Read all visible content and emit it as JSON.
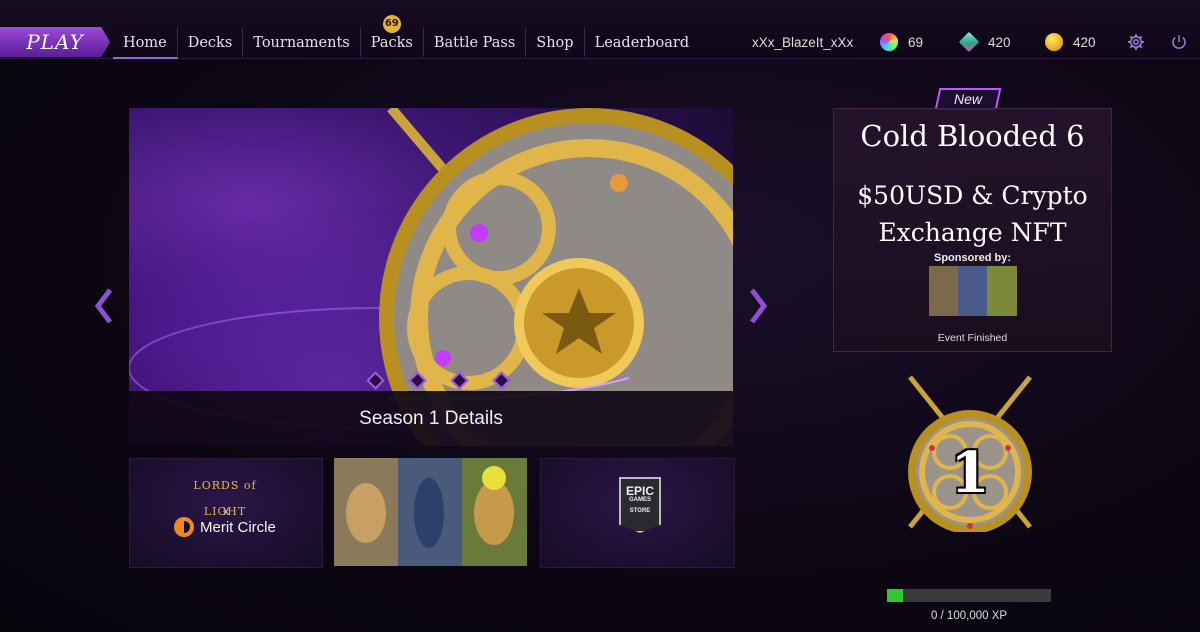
{
  "header": {
    "play_label": "PLAY",
    "nav": [
      {
        "label": "Home",
        "active": true
      },
      {
        "label": "Decks"
      },
      {
        "label": "Tournaments"
      },
      {
        "label": "Packs",
        "badge": "69"
      },
      {
        "label": "Battle Pass"
      },
      {
        "label": "Shop"
      },
      {
        "label": "Leaderboard"
      }
    ],
    "username": "xXx_BlazeIt_xXx",
    "currencies": {
      "gems": {
        "icon": "rainbow-gem-icon",
        "value": "69"
      },
      "shards": {
        "icon": "crystal-cube-icon",
        "value": "420"
      },
      "coins": {
        "icon": "gold-coin-icon",
        "value": "420"
      }
    },
    "icons": {
      "settings": "gear-icon",
      "logout": "power-icon"
    }
  },
  "banner": {
    "caption": "Season 1 Details",
    "slide_count": 4
  },
  "promo_tiles": {
    "tile1": {
      "logo_text": "LORDS of LIGHT",
      "separator": "x",
      "partner": "Merit Circle"
    },
    "tile3": {
      "line1": "EPIC",
      "line2": "GAMES",
      "line3": "STORE"
    }
  },
  "event": {
    "tag": "New",
    "title": "Cold Blooded 6",
    "prize_line1": "$50USD & Crypto",
    "prize_line2": "Exchange NFT",
    "sponsored_label": "Sponsored by:",
    "status": "Event Finished"
  },
  "rank": {
    "level": "1",
    "xp_label": "0 / 100,000 XP",
    "xp_fill_fraction": 0.1
  },
  "colors": {
    "accent_purple": "#9b5ee0",
    "gold": "#e0b23a",
    "xp_green": "#2fc82f"
  }
}
